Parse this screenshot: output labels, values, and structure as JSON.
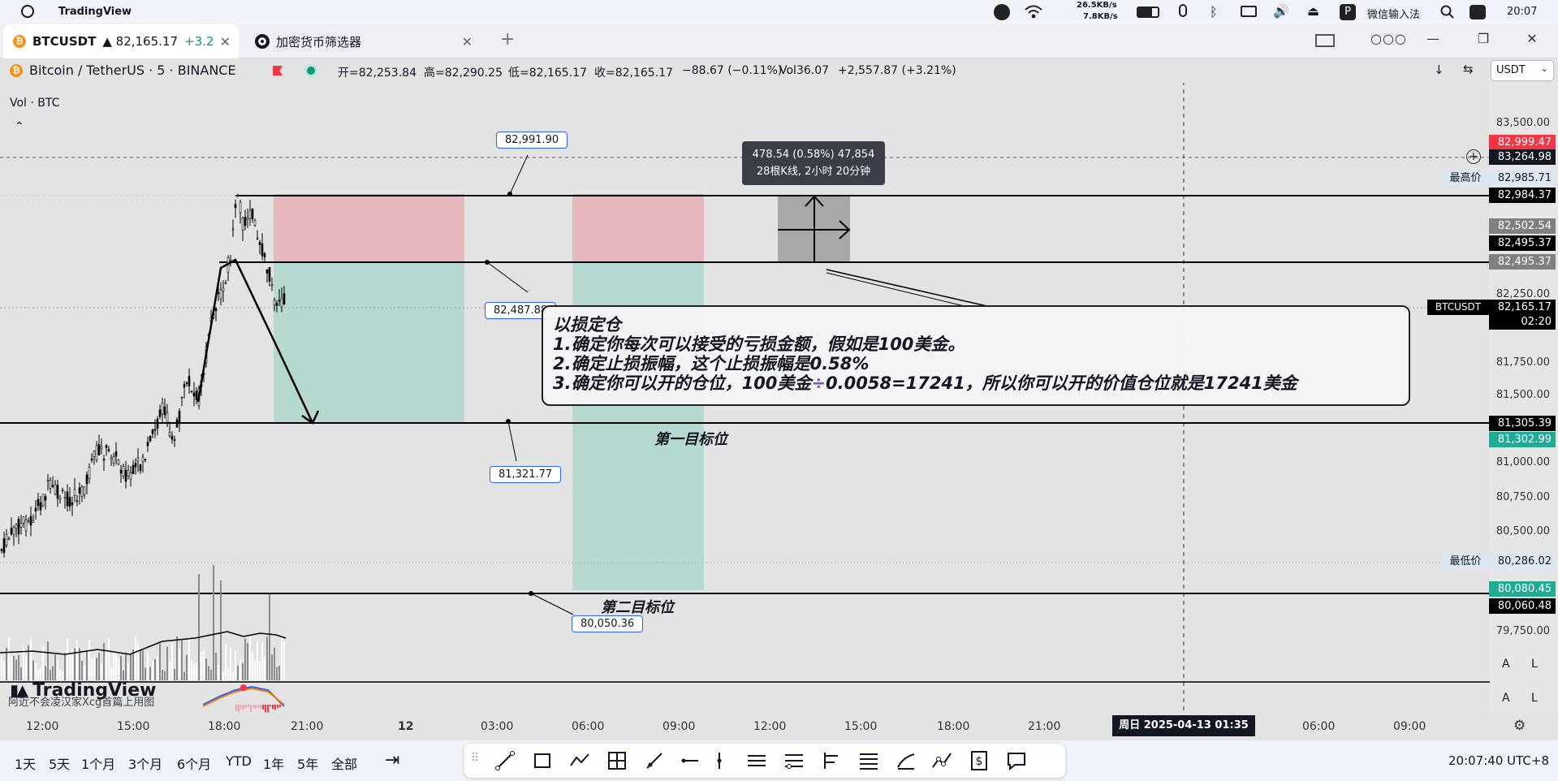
{
  "titlebar": {
    "app": "TradingView",
    "net_up": "26.5KB/s",
    "net_down": "7.8KB/s",
    "ime": "微信输入法",
    "clock": "20:07"
  },
  "tabs": [
    {
      "icon": "bitcoin-icon",
      "label": "BTCUSDT",
      "price": "▲ 82,165.17",
      "change": "+3.2"
    },
    {
      "icon": "screener-icon",
      "label": "加密货币筛选器"
    }
  ],
  "header": {
    "symbol": "Bitcoin / TetherUS · 5 · BINANCE",
    "open": "开=82,253.84",
    "high": "高=82,290.25",
    "low": "低=82,165.17",
    "close": "收=82,165.17",
    "delta": "−88.67 (−0.11%)",
    "vol": "Vol36.07",
    "change": "+2,557.87 (+3.21%)",
    "currency": "USDT",
    "sub_legend": "Vol · BTC"
  },
  "price_axis": {
    "ticks": [
      "83,500.00",
      "82,250.00",
      "81,750.00",
      "81,500.00",
      "81,000.00",
      "80,750.00",
      "80,500.00",
      "79,750.00"
    ],
    "labels": [
      {
        "text": "82,999.47",
        "color": "#f23645"
      },
      {
        "text": "83,264.98",
        "color": "#131722"
      },
      {
        "text": "82,985.71",
        "color": "#dde7f3"
      },
      {
        "text": "82,984.37",
        "color": "#000000"
      },
      {
        "text": "82,502.54",
        "color": "#808080"
      },
      {
        "text": "82,495.37",
        "color": "#000000"
      },
      {
        "text": "82,495.37",
        "color": "#808080"
      },
      {
        "text": "82,165.17",
        "color": "#000000"
      },
      {
        "text": "02:20",
        "color": "#000000"
      },
      {
        "text": "81,305.39",
        "color": "#000000"
      },
      {
        "text": "81,302.99",
        "color": "#22ab94"
      },
      {
        "text": "80,286.02",
        "color": "#dde7f3"
      },
      {
        "text": "80,080.45",
        "color": "#22ab94"
      },
      {
        "text": "80,060.48",
        "color": "#000000"
      }
    ],
    "high_tag": "最高价",
    "low_tag": "最低价",
    "symbol_tag": "BTCUSDT",
    "auto_a": "A",
    "log_l": "L"
  },
  "time_axis": {
    "ticks": [
      "12:00",
      "15:00",
      "18:00",
      "21:00",
      "12",
      "03:00",
      "06:00",
      "09:00",
      "12:00",
      "15:00",
      "18:00",
      "21:00",
      "06:00",
      "09:00"
    ],
    "crosshair": "周日 2025-04-13   01:35"
  },
  "drawings": {
    "measure_line1": "478.54 (0.58%) 47,854",
    "measure_line2": "28根K线, 2小时 20分钟",
    "box_82991": "82,991.90",
    "box_82487": "82,487.88",
    "box_81321": "81,321.77",
    "box_80050": "80,050.36",
    "target1": "第一目标位",
    "target2": "第二目标位",
    "note_title": "以损定仓",
    "note_1": "1.确定你每次可以接受的亏损金额，假如是100美金。",
    "note_2": "2.确定止损振幅，这个止损振幅是0.58%",
    "note_3a": "3.确定你可以开的仓位，100美金",
    "note_3b": "0.0058=17241，所以你可以开的价值仓位就是17241美金"
  },
  "watermark": "TradingView",
  "watermark_sub": "阿近不会凌汉家Xcg首篇上用图",
  "bottombar": {
    "ranges": [
      "1天",
      "5天",
      "1个月",
      "3个月",
      "6个月",
      "YTD",
      "1年",
      "5年",
      "全部"
    ],
    "clock": "20:07:40 UTC+8"
  }
}
